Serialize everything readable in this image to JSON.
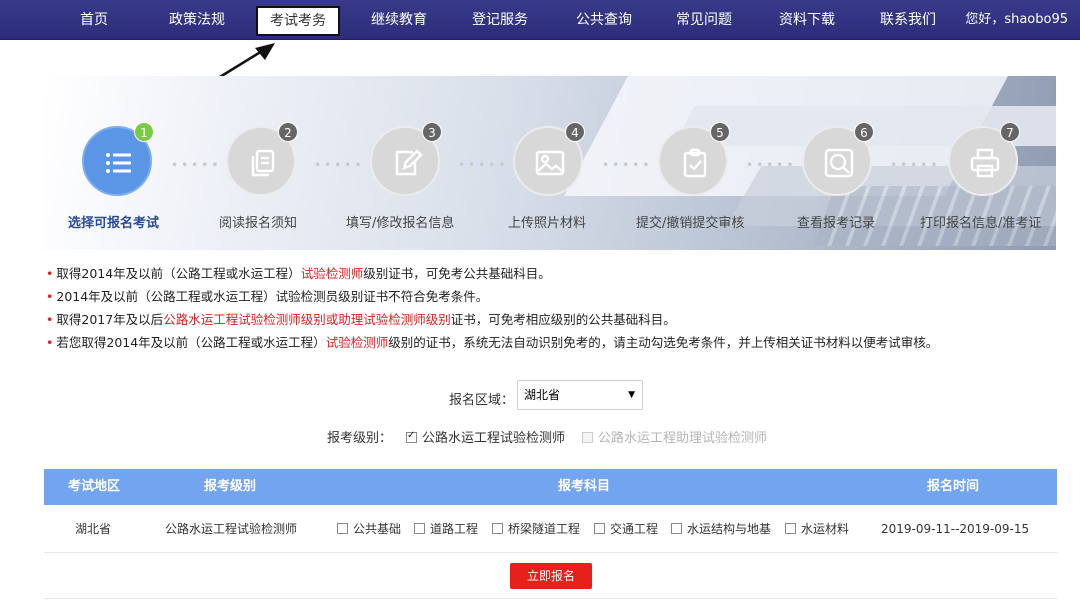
{
  "nav": {
    "items": [
      "首页",
      "政策法规",
      "考试考务",
      "继续教育",
      "登记服务",
      "公共查询",
      "常见问题",
      "资料下载",
      "联系我们"
    ],
    "active_index": 2,
    "greeting": "您好，shaobo95"
  },
  "steps": [
    {
      "num": "1",
      "label": "选择可报名考试",
      "icon": "list-icon"
    },
    {
      "num": "2",
      "label": "阅读报名须知",
      "icon": "documents-icon"
    },
    {
      "num": "3",
      "label": "填写/修改报名信息",
      "icon": "edit-icon"
    },
    {
      "num": "4",
      "label": "上传照片材料",
      "icon": "image-icon"
    },
    {
      "num": "5",
      "label": "提交/撤销提交审核",
      "icon": "clipboard-check-icon"
    },
    {
      "num": "6",
      "label": "查看报考记录",
      "icon": "search-record-icon"
    },
    {
      "num": "7",
      "label": "打印报名信息/准考证",
      "icon": "printer-icon"
    }
  ],
  "notes": [
    [
      {
        "t": "取得2014年及以前（公路工程或水运工程）"
      },
      {
        "t": "试验检测师",
        "red": true
      },
      {
        "t": "级别证书，可免考公共基础科目。"
      }
    ],
    [
      {
        "t": "2014年及以前（公路工程或水运工程）试验检测员级别证书不符合免考条件。"
      }
    ],
    [
      {
        "t": "取得2017年及以后"
      },
      {
        "t": "公路水运工程试验检测师级别或助理试验检测师级别",
        "red": true
      },
      {
        "t": "证书，可免考相应级别的公共基础科目。"
      }
    ],
    [
      {
        "t": "若您取得2014年及以前（公路工程或水运工程）"
      },
      {
        "t": "试验检测师",
        "red": true
      },
      {
        "t": "级别的证书，系统无法自动识别免考的，请主动勾选免考条件，并上传相关证书材料以便考试审核。"
      }
    ]
  ],
  "form": {
    "region_label": "报名区域：",
    "region_value": "湖北省",
    "level_label": "报考级别：",
    "level_options": [
      {
        "label": "公路水运工程试验检测师",
        "checked": true,
        "disabled": false
      },
      {
        "label": "公路水运工程助理试验检测师",
        "checked": false,
        "disabled": true
      }
    ]
  },
  "table": {
    "headers": [
      "考试地区",
      "报考级别",
      "报考科目",
      "报名时间"
    ],
    "row": {
      "region": "湖北省",
      "level": "公路水运工程试验检测师",
      "subjects": [
        "公共基础",
        "道路工程",
        "桥梁隧道工程",
        "交通工程",
        "水运结构与地基",
        "水运材料"
      ],
      "time": "2019-09-11--2019-09-15"
    }
  },
  "apply_button": "立即报名",
  "colors": {
    "nav_bg": "#2c2c7a",
    "header_blue": "#72a4ef",
    "step_active": "#5b95e6",
    "badge_green": "#7ac943",
    "accent_red": "#e02020"
  }
}
